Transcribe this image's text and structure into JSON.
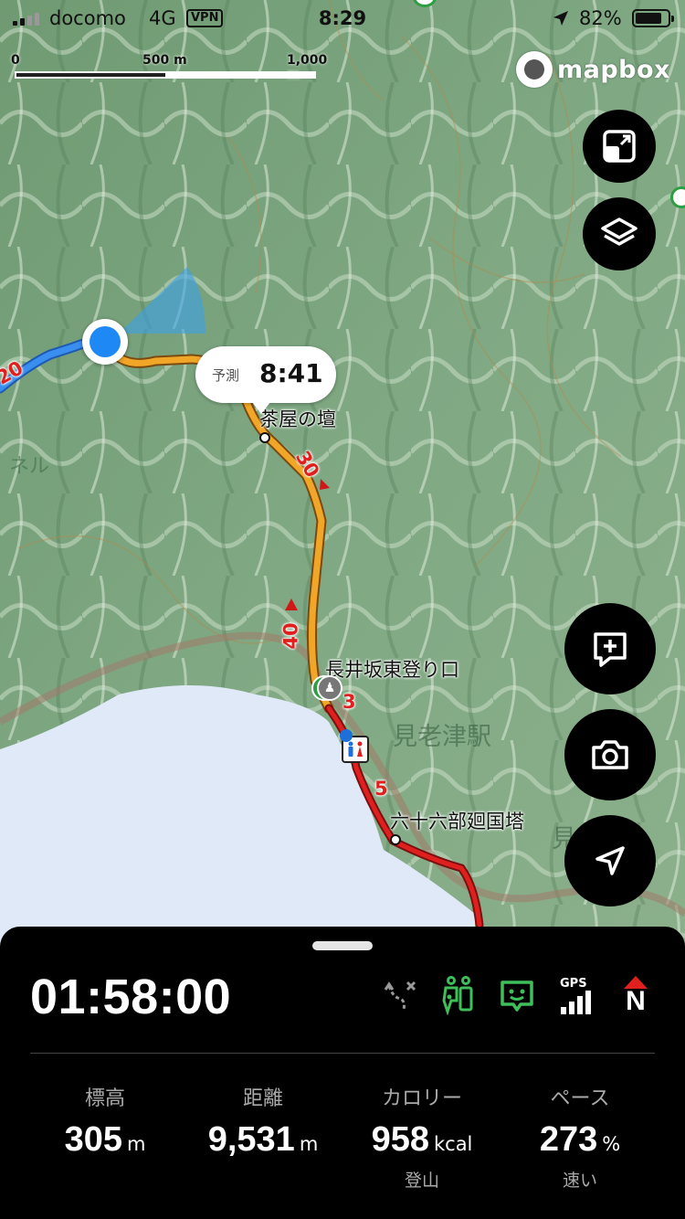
{
  "status_bar": {
    "carrier": "docomo",
    "network": "4G",
    "vpn": "VPN",
    "time": "8:29",
    "battery_percent": "82%",
    "battery_level": 0.82
  },
  "scale_bar": {
    "label_start": "0",
    "label_mid": "500 m",
    "label_end": "1,000 m",
    "filled_fraction": 0.5
  },
  "map": {
    "attribution": "mapbox",
    "eta_label": "予測",
    "eta_time": "8:41",
    "places": {
      "teahouse": "茶屋の壇",
      "trailhead": "長井坂東登り口",
      "station": "見老津駅",
      "tower": "六十六部廻国塔"
    },
    "distance_markers": {
      "m20": "20",
      "m30": "30",
      "m40": "40",
      "m3": "3",
      "m5": "5"
    },
    "fragments": {
      "tunnel": "ネル",
      "edge": "見"
    }
  },
  "controls": {
    "icons": [
      "expand-icon",
      "layers-icon",
      "add-note-icon",
      "camera-icon",
      "navigate-icon"
    ]
  },
  "panel": {
    "elapsed_time": "01:58:00",
    "status_icons": [
      "route-off-icon",
      "location-sharing-icon",
      "chat-icon",
      "gps-signal-icon",
      "compass-north-icon"
    ],
    "gps_label": "GPS",
    "compass_label": "N",
    "stats": {
      "elevation": {
        "label": "標高",
        "value": "305",
        "unit": "m"
      },
      "distance": {
        "label": "距離",
        "value": "9,531",
        "unit": "m"
      },
      "calories": {
        "label": "カロリー",
        "value": "958",
        "unit": "kcal",
        "sub": "登山"
      },
      "pace": {
        "label": "ペース",
        "value": "273",
        "unit": "%",
        "sub": "速い"
      }
    }
  },
  "colors": {
    "route_walked": "#3a8ef0",
    "route_ahead": "#f2a627",
    "route_later": "#e0201e",
    "user_location": "#1e88f5",
    "accent_green": "#3fbf5a"
  }
}
